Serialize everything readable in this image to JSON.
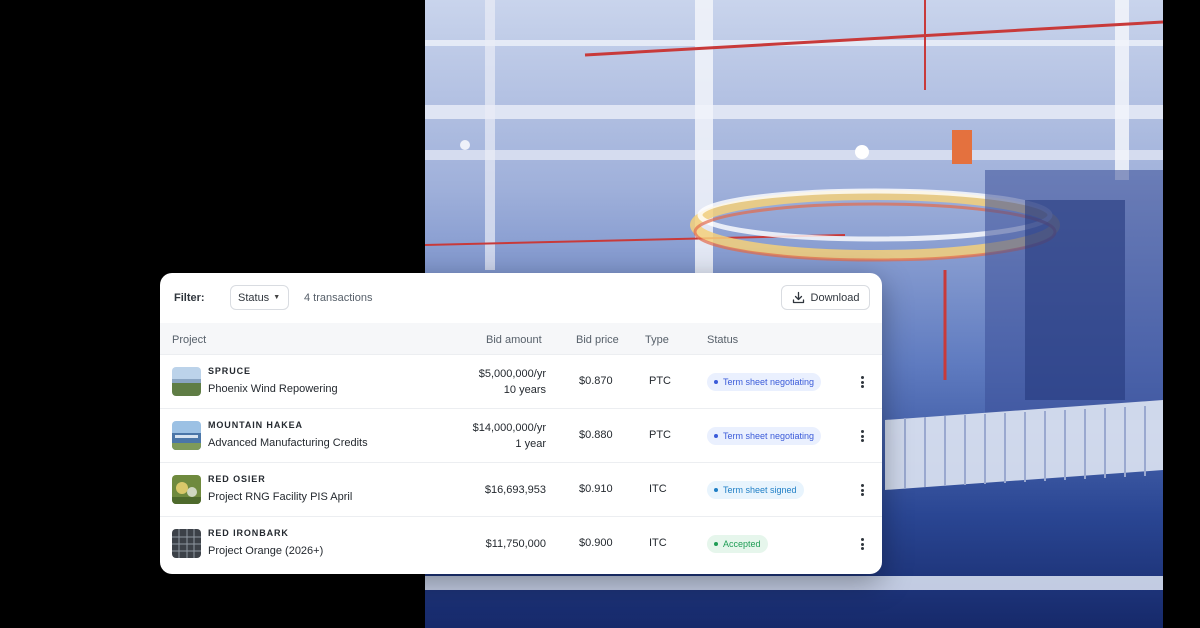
{
  "toolbar": {
    "filter_label": "Filter:",
    "status_filter": "Status",
    "transaction_count": "4 transactions",
    "download_label": "Download"
  },
  "columns": {
    "project": "Project",
    "bid_amount": "Bid amount",
    "bid_price": "Bid price",
    "type": "Type",
    "status": "Status"
  },
  "rows": [
    {
      "code": "SPRUCE",
      "name": "Phoenix Wind Repowering",
      "amount_line1": "$5,000,000/yr",
      "amount_line2": "10 years",
      "price": "$0.870",
      "type": "PTC",
      "status": "Term sheet negotiating",
      "status_kind": "negotiating",
      "thumb_icon": "wind-farm-thumbnail"
    },
    {
      "code": "MOUNTAIN HAKEA",
      "name": "Advanced Manufacturing Credits",
      "amount_line1": "$14,000,000/yr",
      "amount_line2": "1 year",
      "price": "$0.880",
      "type": "PTC",
      "status": "Term sheet negotiating",
      "status_kind": "negotiating",
      "thumb_icon": "manufacturing-thumbnail"
    },
    {
      "code": "RED OSIER",
      "name": "Project RNG Facility PIS April",
      "amount_line1": "$16,693,953",
      "amount_line2": "",
      "price": "$0.910",
      "type": "ITC",
      "status": "Term sheet signed",
      "status_kind": "signed",
      "thumb_icon": "rng-facility-thumbnail"
    },
    {
      "code": "RED IRONBARK",
      "name": "Project Orange (2026+)",
      "amount_line1": "$11,750,000",
      "amount_line2": "",
      "price": "$0.900",
      "type": "ITC",
      "status": "Accepted",
      "status_kind": "accepted",
      "thumb_icon": "solar-panel-thumbnail"
    }
  ],
  "colors": {
    "negotiating": "#3b5bd9",
    "signed": "#1f7fc6",
    "accepted": "#1f9d55"
  }
}
